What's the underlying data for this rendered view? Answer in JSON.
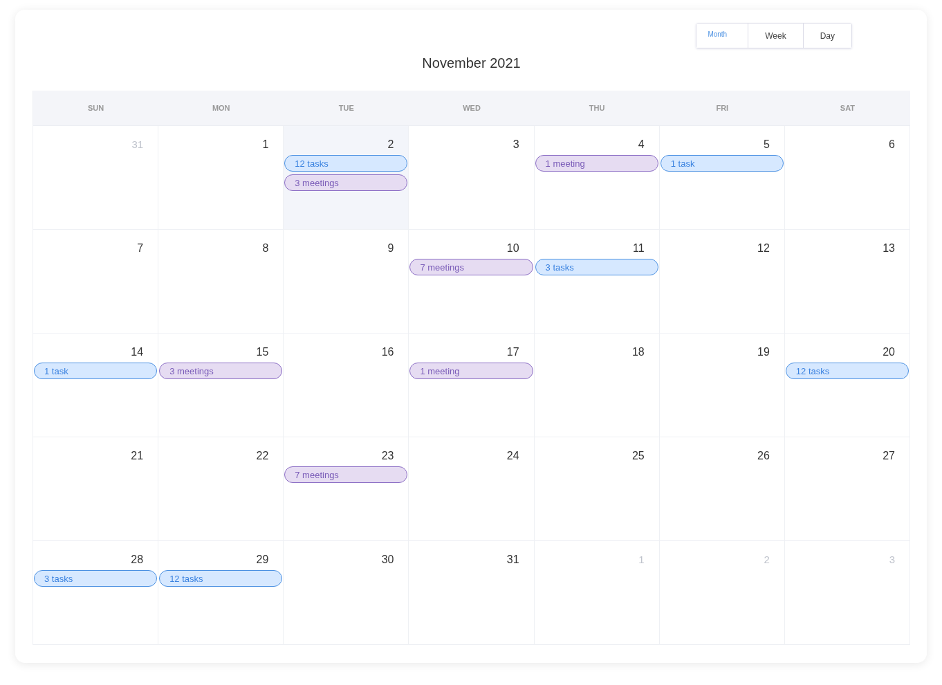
{
  "views": [
    {
      "label": "Month",
      "selected": true
    },
    {
      "label": "Week",
      "selected": false
    },
    {
      "label": "Day",
      "selected": false
    }
  ],
  "title": "November 2021",
  "weekdays": [
    "SUN",
    "MON",
    "TUE",
    "WED",
    "THU",
    "FRI",
    "SAT"
  ],
  "days": [
    {
      "number": "31",
      "outside": true,
      "selected": false
    },
    {
      "number": "1",
      "outside": false,
      "selected": false
    },
    {
      "number": "2",
      "outside": false,
      "selected": true,
      "events": [
        {
          "kind": "task",
          "label": "12 tasks"
        },
        {
          "kind": "meeting",
          "label": "3 meetings"
        }
      ]
    },
    {
      "number": "3",
      "outside": false,
      "selected": false
    },
    {
      "number": "4",
      "outside": false,
      "selected": false,
      "events": [
        {
          "kind": "meeting",
          "label": "1 meeting"
        }
      ]
    },
    {
      "number": "5",
      "outside": false,
      "selected": false,
      "events": [
        {
          "kind": "task",
          "label": "1 task"
        }
      ]
    },
    {
      "number": "6",
      "outside": false,
      "selected": false
    },
    {
      "number": "7",
      "outside": false,
      "selected": false
    },
    {
      "number": "8",
      "outside": false,
      "selected": false
    },
    {
      "number": "9",
      "outside": false,
      "selected": false
    },
    {
      "number": "10",
      "outside": false,
      "selected": false,
      "events": [
        {
          "kind": "meeting",
          "label": "7 meetings"
        }
      ]
    },
    {
      "number": "11",
      "outside": false,
      "selected": false,
      "events": [
        {
          "kind": "task",
          "label": "3 tasks"
        }
      ]
    },
    {
      "number": "12",
      "outside": false,
      "selected": false
    },
    {
      "number": "13",
      "outside": false,
      "selected": false
    },
    {
      "number": "14",
      "outside": false,
      "selected": false,
      "events": [
        {
          "kind": "task",
          "label": "1 task"
        }
      ]
    },
    {
      "number": "15",
      "outside": false,
      "selected": false,
      "events": [
        {
          "kind": "meeting",
          "label": "3 meetings"
        }
      ]
    },
    {
      "number": "16",
      "outside": false,
      "selected": false
    },
    {
      "number": "17",
      "outside": false,
      "selected": false,
      "events": [
        {
          "kind": "meeting",
          "label": "1 meeting"
        }
      ]
    },
    {
      "number": "18",
      "outside": false,
      "selected": false
    },
    {
      "number": "19",
      "outside": false,
      "selected": false
    },
    {
      "number": "20",
      "outside": false,
      "selected": false,
      "events": [
        {
          "kind": "task",
          "label": "12 tasks"
        }
      ]
    },
    {
      "number": "21",
      "outside": false,
      "selected": false
    },
    {
      "number": "22",
      "outside": false,
      "selected": false
    },
    {
      "number": "23",
      "outside": false,
      "selected": false,
      "events": [
        {
          "kind": "meeting",
          "label": "7 meetings"
        }
      ]
    },
    {
      "number": "24",
      "outside": false,
      "selected": false
    },
    {
      "number": "25",
      "outside": false,
      "selected": false
    },
    {
      "number": "26",
      "outside": false,
      "selected": false
    },
    {
      "number": "27",
      "outside": false,
      "selected": false
    },
    {
      "number": "28",
      "outside": false,
      "selected": false,
      "events": [
        {
          "kind": "task",
          "label": "3 tasks"
        }
      ]
    },
    {
      "number": "29",
      "outside": false,
      "selected": false,
      "events": [
        {
          "kind": "task",
          "label": "12 tasks"
        }
      ]
    },
    {
      "number": "30",
      "outside": false,
      "selected": false
    },
    {
      "number": "31",
      "outside": false,
      "selected": false
    },
    {
      "number": "1",
      "outside": true,
      "selected": false
    },
    {
      "number": "2",
      "outside": true,
      "selected": false
    },
    {
      "number": "3",
      "outside": true,
      "selected": false
    }
  ]
}
